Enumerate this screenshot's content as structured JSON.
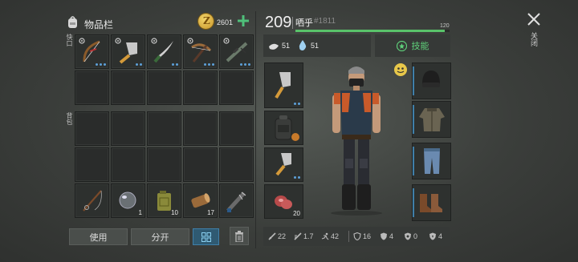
{
  "inventory": {
    "title": "物品栏",
    "coins": "2601",
    "sections": {
      "quick": "快口",
      "backpack": "背包"
    },
    "quick_slots": [
      {
        "icon": "bow-icon",
        "dots": 3
      },
      {
        "icon": "cleaver-icon",
        "dots": 2
      },
      {
        "icon": "machete-icon",
        "dots": 2
      },
      {
        "icon": "crossbow-icon",
        "dots": 3
      },
      {
        "icon": "rifle-icon",
        "dots": 3
      }
    ],
    "bottom_row": [
      {
        "icon": "fishing-rod-icon",
        "qty": ""
      },
      {
        "icon": "glass-sphere-icon",
        "qty": "1"
      },
      {
        "icon": "fuel-can-icon",
        "qty": "10"
      },
      {
        "icon": "log-icon",
        "qty": "17"
      },
      {
        "icon": "spiked-bat-icon",
        "qty": ""
      }
    ],
    "buttons": {
      "use": "使用",
      "split": "分开"
    }
  },
  "character": {
    "level": "209",
    "name": "哂乎",
    "id": "#1811",
    "xp_max": "120",
    "xp_fraction": 0.97,
    "food": "51",
    "water": "51",
    "skills_label": "技能",
    "left_equip": [
      {
        "icon": "cleaver-icon",
        "qty": ""
      },
      {
        "icon": "backpack-icon",
        "qty": ""
      },
      {
        "icon": "cleaver-icon",
        "qty": ""
      },
      {
        "icon": "meat-icon",
        "qty": "20"
      }
    ],
    "right_equip": [
      "helmet-icon",
      "jacket-icon",
      "pants-icon",
      "boots-icon"
    ],
    "stats": [
      {
        "icon": "sword-icon",
        "value": "22"
      },
      {
        "icon": "speed-icon",
        "value": "1.7"
      },
      {
        "icon": "run-icon",
        "value": "42"
      },
      {
        "icon": "shield-icon",
        "value": "16"
      },
      {
        "icon": "armor-icon",
        "value": "4"
      },
      {
        "icon": "cold-icon",
        "value": "0"
      },
      {
        "icon": "heat-icon",
        "value": "4"
      }
    ]
  },
  "close_label": "关闭"
}
